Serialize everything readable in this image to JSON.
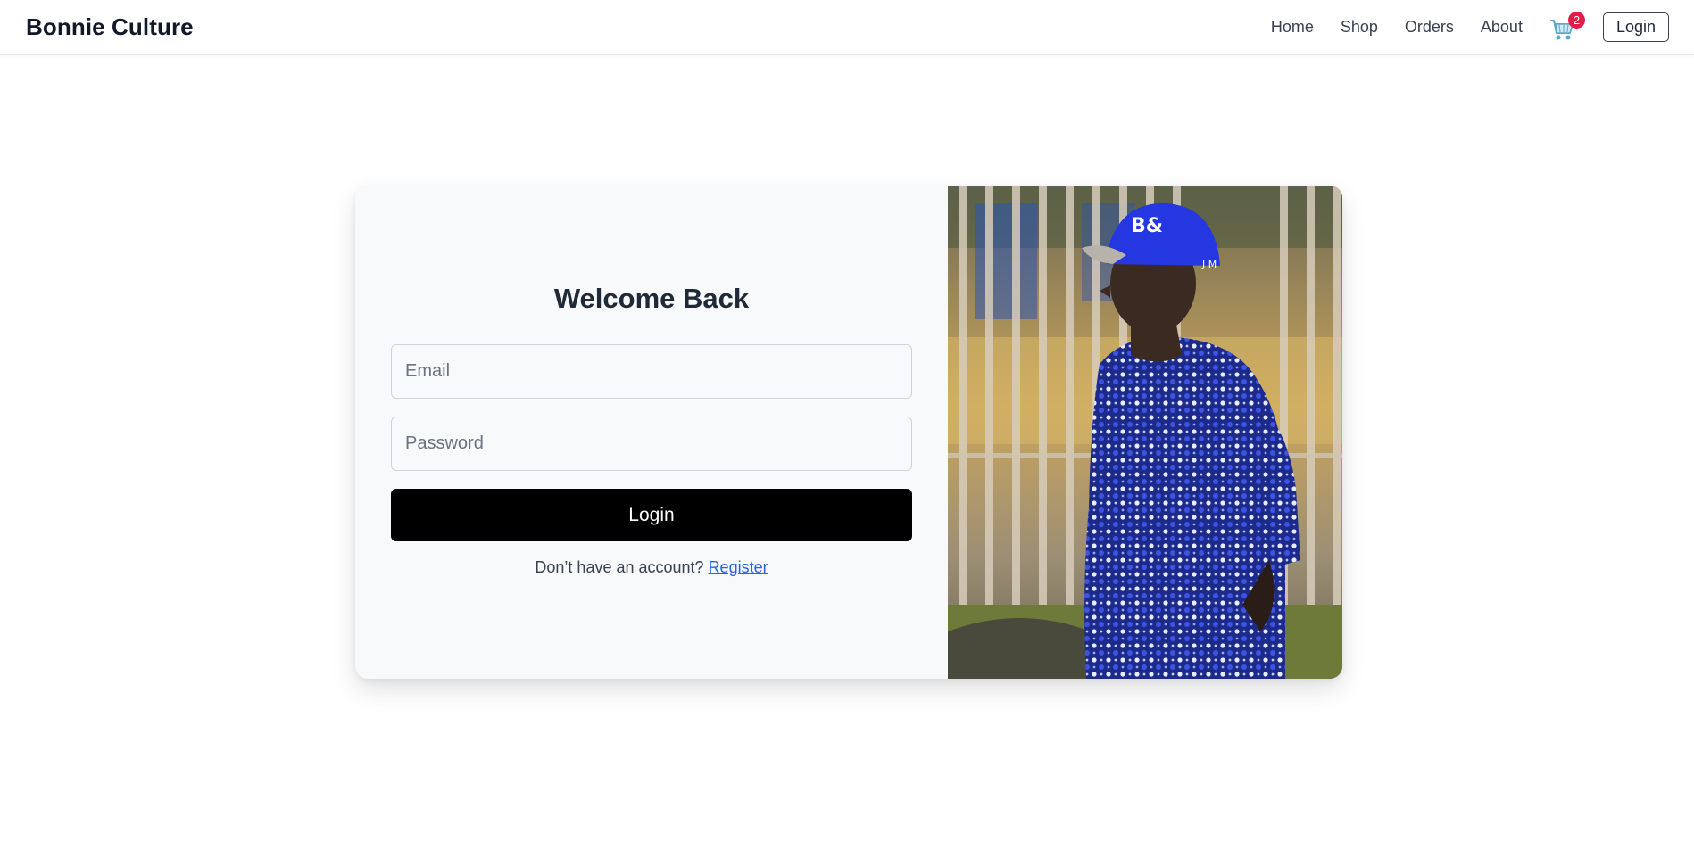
{
  "navbar": {
    "brand": "Bonnie Culture",
    "links": [
      "Home",
      "Shop",
      "Orders",
      "About"
    ],
    "cart_icon": "shopping-cart-icon",
    "cart_count": "2",
    "login_label": "Login"
  },
  "login_form": {
    "title": "Welcome Back",
    "email_placeholder": "Email",
    "password_placeholder": "Password",
    "submit_label": "Login",
    "register_prompt": "Don’t have an account?",
    "register_link": "Register"
  },
  "colors": {
    "accent": "#000000",
    "link": "#2563eb",
    "badge": "#e11d48",
    "card_background": "#f8f9fa"
  }
}
